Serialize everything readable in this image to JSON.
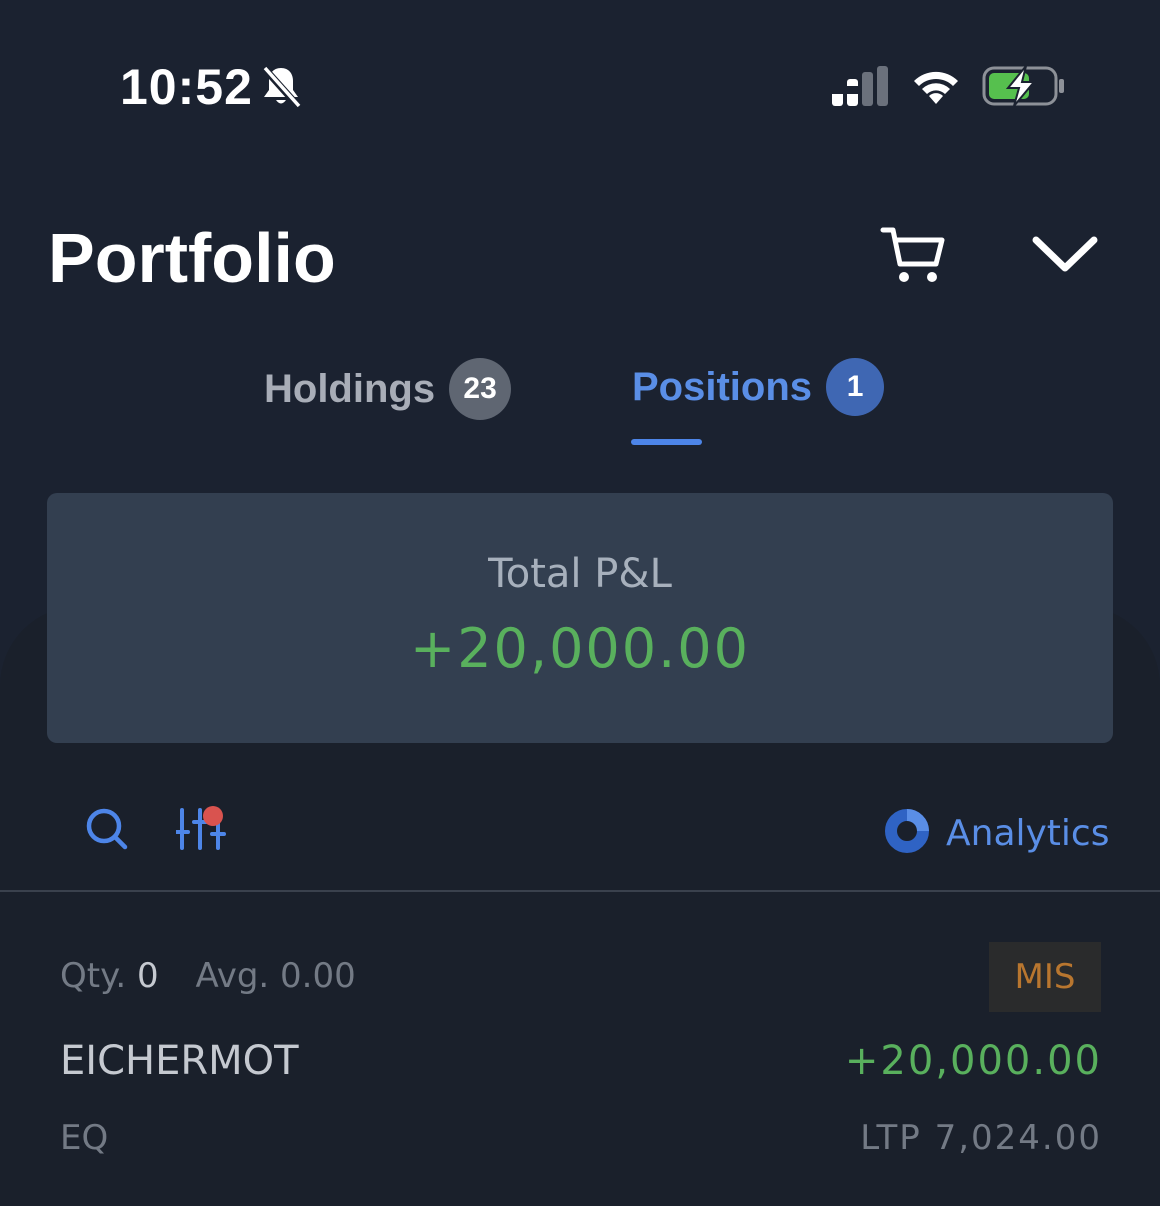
{
  "status_bar": {
    "time": "10:52",
    "icons": [
      "bell-slash-icon",
      "signal-icon",
      "wifi-icon",
      "battery-charging-icon"
    ]
  },
  "header": {
    "title": "Portfolio",
    "icons": [
      "cart-icon",
      "chevron-down-icon"
    ]
  },
  "tabs": [
    {
      "label": "Holdings",
      "count": "23",
      "active": false
    },
    {
      "label": "Positions",
      "count": "1",
      "active": true
    }
  ],
  "summary": {
    "label": "Total P&L",
    "value": "+20,000.00"
  },
  "toolbar": {
    "analytics_label": "Analytics",
    "icons": [
      "search-icon",
      "filter-icon",
      "analytics-icon"
    ]
  },
  "positions": [
    {
      "qty_label": "Qty.",
      "qty": "0",
      "avg_label": "Avg.",
      "avg": "0.00",
      "product": "MIS",
      "symbol": "EICHERMOT",
      "pnl": "+20,000.00",
      "segment": "EQ",
      "ltp_label": "LTP",
      "ltp": "7,024.00"
    }
  ],
  "colors": {
    "background": "#1b2230",
    "card": "#333f50",
    "accent": "#5a8ee6",
    "profit": "#59b05d",
    "product_badge": "#b8762f",
    "filter_dot": "#d9534f"
  }
}
